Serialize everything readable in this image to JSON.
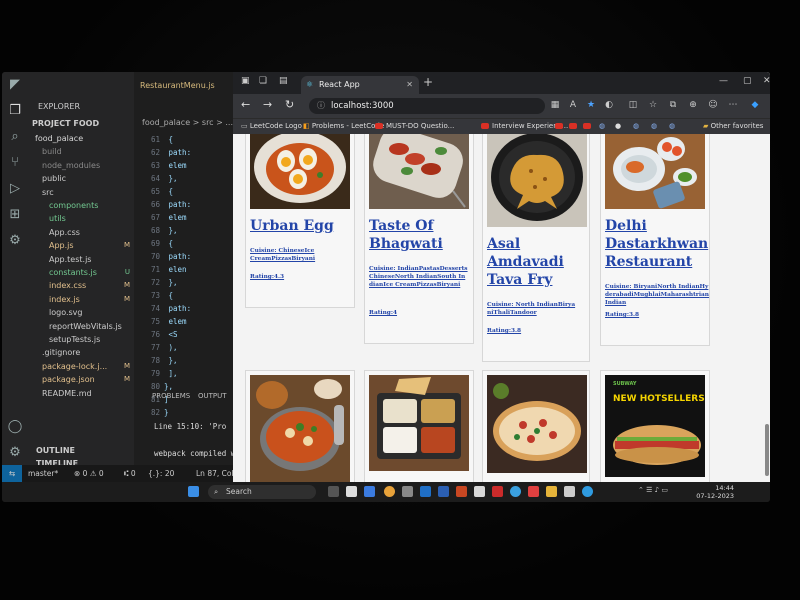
{
  "vscode": {
    "explorer_title": "EXPLORER",
    "project_title": "PROJECT FOOD",
    "tree": [
      {
        "label": "food_palace",
        "indent": 1,
        "color": "#d7d7d7",
        "badge": ""
      },
      {
        "label": "build",
        "indent": 2,
        "color": "#8a8a8a",
        "badge": ""
      },
      {
        "label": "node_modules",
        "indent": 2,
        "color": "#8a8a8a",
        "badge": ""
      },
      {
        "label": "public",
        "indent": 2,
        "color": "#cccccc",
        "badge": ""
      },
      {
        "label": "src",
        "indent": 2,
        "color": "#cccccc",
        "badge": ""
      },
      {
        "label": "components",
        "indent": 3,
        "color": "#73c991",
        "badge": ""
      },
      {
        "label": "utils",
        "indent": 3,
        "color": "#73c991",
        "badge": ""
      },
      {
        "label": "App.css",
        "indent": 3,
        "color": "#cccccc",
        "badge": ""
      },
      {
        "label": "App.js",
        "indent": 3,
        "color": "#e2c08d",
        "badge": "M"
      },
      {
        "label": "App.test.js",
        "indent": 3,
        "color": "#cccccc",
        "badge": ""
      },
      {
        "label": "constants.js",
        "indent": 3,
        "color": "#73c991",
        "badge": "U"
      },
      {
        "label": "index.css",
        "indent": 3,
        "color": "#e2c08d",
        "badge": "M"
      },
      {
        "label": "index.js",
        "indent": 3,
        "color": "#e2c08d",
        "badge": "M"
      },
      {
        "label": "logo.svg",
        "indent": 3,
        "color": "#cccccc",
        "badge": ""
      },
      {
        "label": "reportWebVitals.js",
        "indent": 3,
        "color": "#cccccc",
        "badge": ""
      },
      {
        "label": "setupTests.js",
        "indent": 3,
        "color": "#cccccc",
        "badge": ""
      },
      {
        "label": ".gitignore",
        "indent": 2,
        "color": "#cccccc",
        "badge": ""
      },
      {
        "label": "package-lock.j...",
        "indent": 2,
        "color": "#e2c08d",
        "badge": "M"
      },
      {
        "label": "package.json",
        "indent": 2,
        "color": "#e2c08d",
        "badge": "M"
      },
      {
        "label": "README.md",
        "indent": 2,
        "color": "#cccccc",
        "badge": ""
      }
    ],
    "outline_label": "OUTLINE",
    "timeline_label": "TIMELINE",
    "editor_tab": "RestaurantMenu.js",
    "breadcrumb": "food_palace > src > ...",
    "code_lines": [
      {
        "n": "61",
        "t": "  {"
      },
      {
        "n": "62",
        "t": "    path:"
      },
      {
        "n": "63",
        "t": "    elem"
      },
      {
        "n": "64",
        "t": "  },"
      },
      {
        "n": "65",
        "t": "  {"
      },
      {
        "n": "66",
        "t": "    path:"
      },
      {
        "n": "67",
        "t": "    elem"
      },
      {
        "n": "68",
        "t": "  },"
      },
      {
        "n": "69",
        "t": "  {"
      },
      {
        "n": "70",
        "t": "    path:"
      },
      {
        "n": "71",
        "t": "    elen"
      },
      {
        "n": "72",
        "t": "  },"
      },
      {
        "n": "73",
        "t": "  {"
      },
      {
        "n": "74",
        "t": "    path:"
      },
      {
        "n": "75",
        "t": "    elem"
      },
      {
        "n": "76",
        "t": "      <S"
      },
      {
        "n": "77",
        "t": "    ),"
      },
      {
        "n": "78",
        "t": "  },"
      },
      {
        "n": "79",
        "t": "  ],"
      },
      {
        "n": "80",
        "t": "},"
      },
      {
        "n": "81",
        "t": "]"
      },
      {
        "n": "82",
        "t": "}"
      }
    ],
    "panel_tabs": [
      "PROBLEMS",
      "OUTPUT"
    ],
    "panel_line1": "Line 15:10:  'Pro",
    "panel_line2": "webpack compiled wi",
    "status": {
      "branch": "master*",
      "errors": "⊗ 0 ⚠ 0",
      "ports": "⑆ 0",
      "braces": "{.}: 20",
      "position": "Ln 87, Col 1"
    }
  },
  "browser": {
    "tab_title": "React App",
    "url": "localhost:3000",
    "bookmarks": [
      "LeetCode Logo",
      "Problems - LeetCode",
      "MUST-DO Questio...",
      "Interview Experienc..."
    ],
    "other_favorites": "Other favorites"
  },
  "restaurants": [
    {
      "name": "Urban Egg",
      "cuisine": "Cuisine: ChineseIce CreamPizzasBiryani",
      "rating": "Rating:4.3"
    },
    {
      "name": "Taste Of Bhagwati",
      "cuisine": "Cuisine: IndianPastasDessertsChineseNorth IndianSouth IndianIce CreamPizzasBiryani",
      "rating": "Rating:4"
    },
    {
      "name": "Asal Amdavadi Tava Fry",
      "cuisine": "Cuisine: North IndianBiryaniThaliTandoor",
      "rating": "Rating:3.8"
    },
    {
      "name": "Delhi Dastarkhwan Restaurant",
      "cuisine": "Cuisine: BiryaniNorth IndianHyderabadiMughlaiMaharashtrianIndian",
      "rating": "Rating:3.8"
    },
    {
      "name": "",
      "cuisine": "",
      "rating": ""
    },
    {
      "name": "",
      "cuisine": "",
      "rating": ""
    },
    {
      "name": "",
      "cuisine": "",
      "rating": ""
    },
    {
      "name": "",
      "cuisine": "",
      "rating": ""
    }
  ],
  "promo_text": {
    "brand": "SUBWAY",
    "headline": "NEW HOTSELLERS"
  },
  "taskbar": {
    "search_label": "Search",
    "time": "14:44",
    "date": "07-12-2023"
  }
}
